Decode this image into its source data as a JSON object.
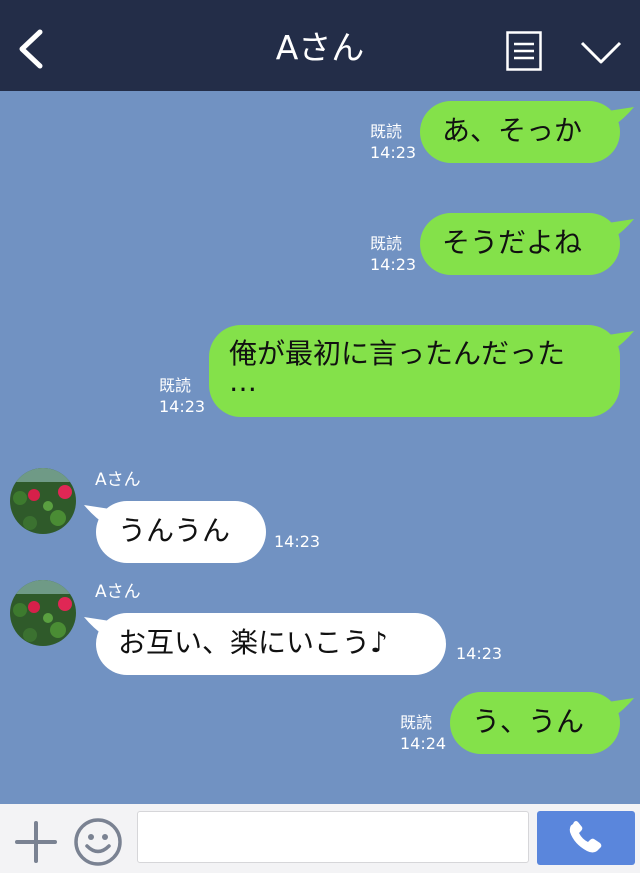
{
  "header": {
    "title": "Aさん"
  },
  "messages": [
    {
      "dir": "out",
      "text": "あ、そっか",
      "read": "既読",
      "time": "14:23"
    },
    {
      "dir": "out",
      "text": "そうだよね",
      "read": "既読",
      "time": "14:23"
    },
    {
      "dir": "out",
      "line1": "俺が最初に言ったんだった",
      "line2": "…",
      "read": "既読",
      "time": "14:23"
    },
    {
      "dir": "in",
      "sender": "Aさん",
      "text": "うんうん",
      "time": "14:23"
    },
    {
      "dir": "in",
      "sender": "Aさん",
      "text": "お互い、楽にいこう♪",
      "time": "14:23"
    },
    {
      "dir": "out",
      "text": "う、うん",
      "read": "既読",
      "time": "14:24"
    }
  ],
  "footer": {
    "input_value": "",
    "input_placeholder": ""
  },
  "colors": {
    "header": "#232d48",
    "chat_bg": "#7192c2",
    "outgoing": "#84e14a",
    "incoming": "#ffffff",
    "call_button": "#5a86dc"
  }
}
